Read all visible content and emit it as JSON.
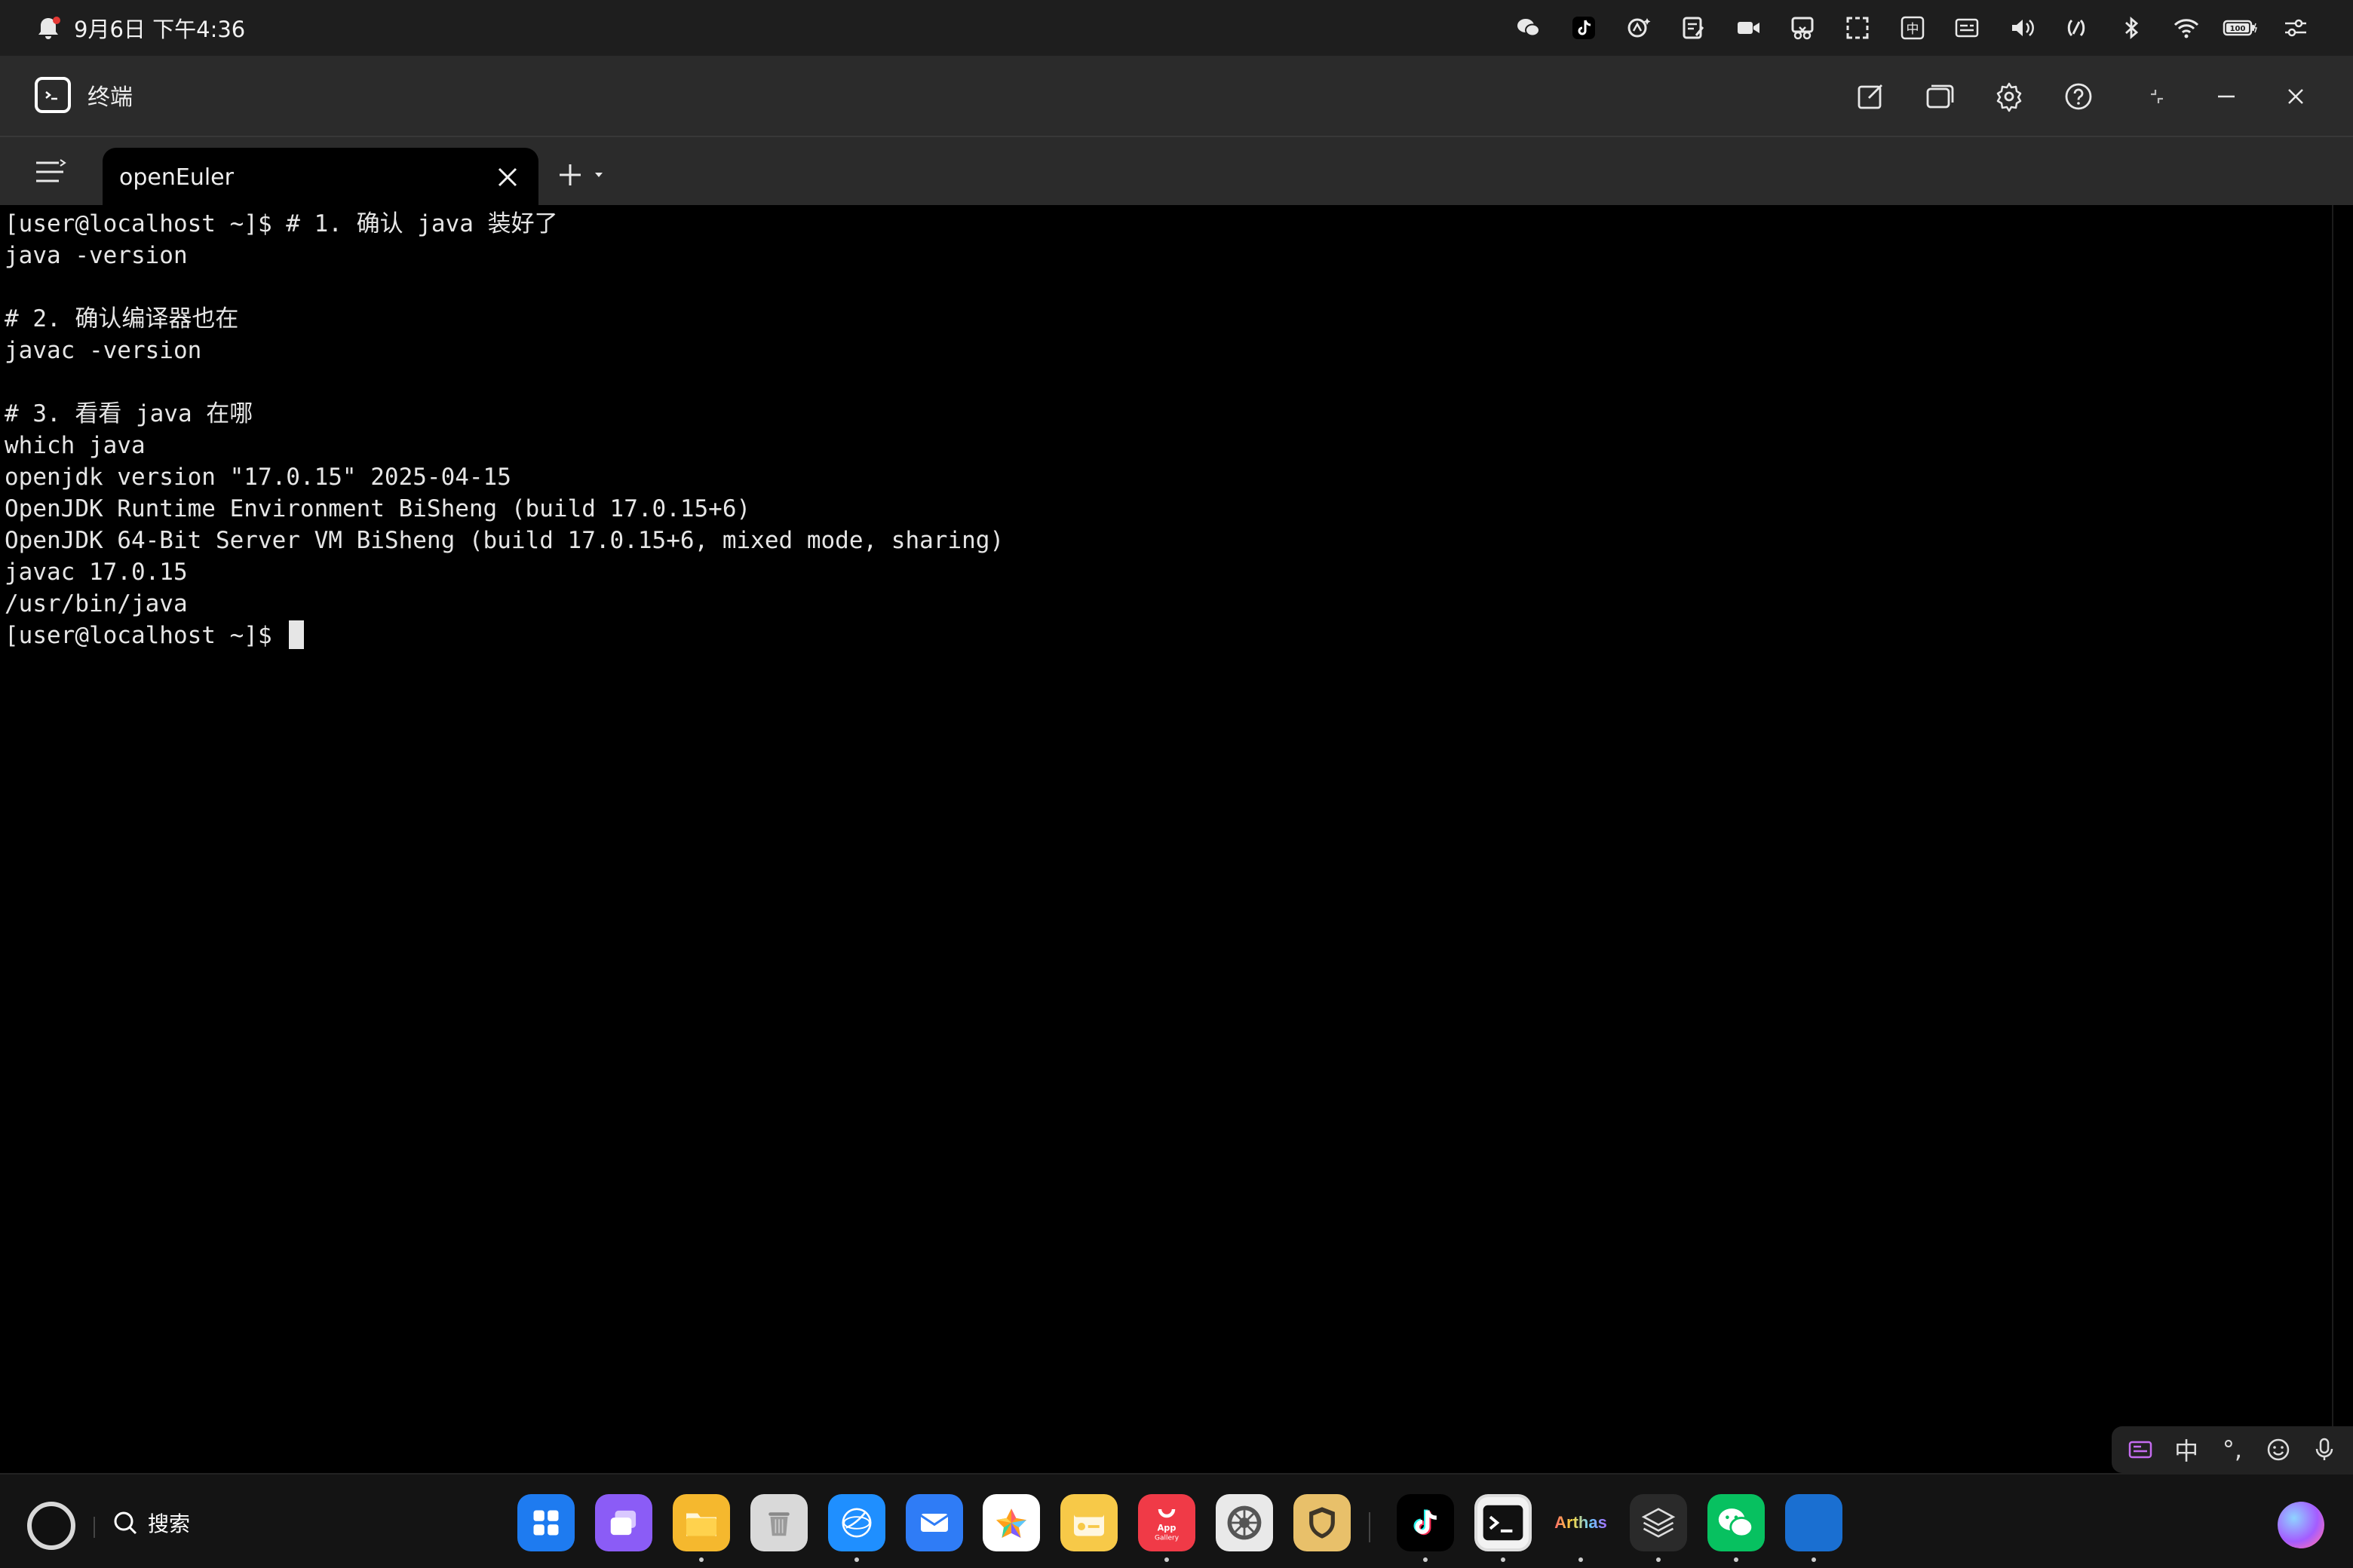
{
  "status_bar": {
    "datetime": "9月6日 下午4:36",
    "icons": [
      "wechat-icon",
      "tiktok-icon",
      "ai-assist-icon",
      "note-icon",
      "video-icon",
      "screenshot-icon",
      "screen-select-icon",
      "zh-input-icon",
      "subtitle-icon",
      "volume-icon",
      "nfc-icon",
      "bluetooth-icon",
      "wifi-icon",
      "battery-icon",
      "settings-toggle-icon"
    ],
    "zh_badge": "中",
    "battery": "100"
  },
  "titlebar": {
    "app_name": "终端",
    "controls": [
      "new-window-icon",
      "window-icon",
      "gear-icon",
      "help-icon",
      "restore-icon",
      "minimize-icon",
      "close-icon"
    ]
  },
  "tabs": [
    {
      "label": "openEuler",
      "active": true
    }
  ],
  "terminal": {
    "lines": [
      "[user@localhost ~]$ # 1. 确认 java 装好了",
      "java -version",
      "",
      "# 2. 确认编译器也在",
      "javac -version",
      "",
      "# 3. 看看 java 在哪",
      "which java",
      "openjdk version \"17.0.15\" 2025-04-15",
      "OpenJDK Runtime Environment BiSheng (build 17.0.15+6)",
      "OpenJDK 64-Bit Server VM BiSheng (build 17.0.15+6, mixed mode, sharing)",
      "javac 17.0.15",
      "/usr/bin/java"
    ],
    "prompt": "[user@localhost ~]$ "
  },
  "ime_toolbar": {
    "zh": "中",
    "punct": "°,"
  },
  "dock": {
    "search_label": "搜索",
    "apps": [
      {
        "name": "app-launcher",
        "color": "#1e7bf0",
        "running": false
      },
      {
        "name": "multitask",
        "color": "#8b5cf6",
        "running": false
      },
      {
        "name": "files",
        "color": "#f5b82e",
        "running": true
      },
      {
        "name": "trash",
        "color": "#d9d9d9",
        "running": false
      },
      {
        "name": "browser",
        "color": "#1f8fff",
        "running": true
      },
      {
        "name": "mail",
        "color": "#2f7cf6",
        "running": false
      },
      {
        "name": "gallery",
        "color": "#ffffff",
        "running": false
      },
      {
        "name": "notes",
        "color": "#f7c948",
        "running": false
      },
      {
        "name": "app-gallery",
        "color": "#f03a47",
        "running": true,
        "text": "App Gallery"
      },
      {
        "name": "system-settings",
        "color": "#e9e9e9",
        "running": false
      },
      {
        "name": "security",
        "color": "#e8c06a",
        "running": false
      },
      {
        "name": "tiktok",
        "color": "#000000",
        "running": true
      },
      {
        "name": "terminal",
        "color": "#f2f2f2",
        "running": true
      },
      {
        "name": "arthas",
        "color": "#141414",
        "running": true,
        "text": "Arthas"
      },
      {
        "name": "layers",
        "color": "#2a2a2a",
        "running": true
      },
      {
        "name": "wechat",
        "color": "#07c160",
        "running": true
      },
      {
        "name": "blue-app",
        "color": "#1a6fd1",
        "running": true
      }
    ]
  }
}
